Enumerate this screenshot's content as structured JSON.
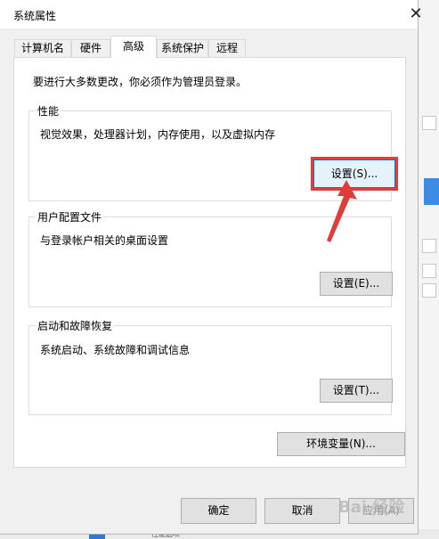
{
  "window": {
    "title": "系统属性",
    "close_glyph": "✕"
  },
  "tabs": [
    {
      "label": "计算机名"
    },
    {
      "label": "硬件"
    },
    {
      "label": "高级"
    },
    {
      "label": "系统保护"
    },
    {
      "label": "远程"
    }
  ],
  "active_tab": "高级",
  "panel": {
    "notice": "要进行大多数更改，你必须作为管理员登录。",
    "performance": {
      "title": "性能",
      "description": "视觉效果，处理器计划，内存使用，以及虚拟内存",
      "button": "设置(S)..."
    },
    "user_profiles": {
      "title": "用户配置文件",
      "description": "与登录帐户相关的桌面设置",
      "button": "设置(E)..."
    },
    "startup_recovery": {
      "title": "启动和故障恢复",
      "description": "系统启动、系统故障和调试信息",
      "button": "设置(T)..."
    },
    "env_button": "环境变量(N)..."
  },
  "footer": {
    "ok": "确定",
    "cancel": "取消",
    "apply": "应用(A)"
  },
  "taskbar_fragment": "性能选项",
  "watermark": "Bai 经验",
  "colors": {
    "highlight_border": "#e03c3c",
    "arrow": "#e03c3c",
    "focus_blue": "#0078d7"
  }
}
